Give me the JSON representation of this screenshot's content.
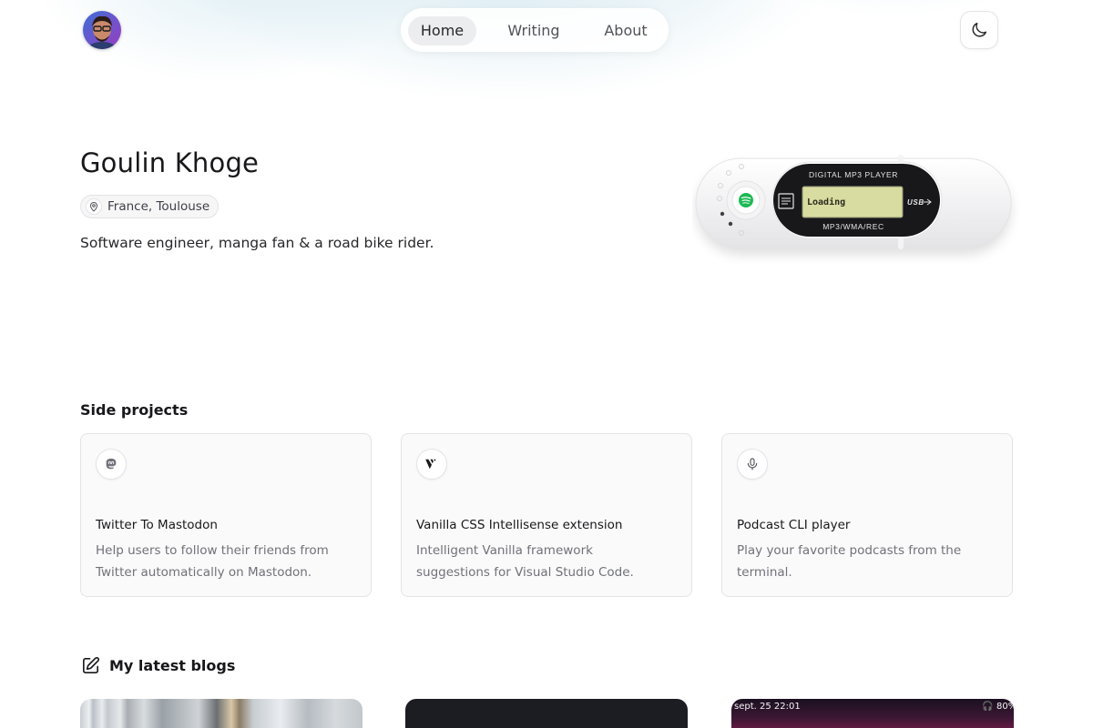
{
  "header": {
    "nav": [
      {
        "label": "Home",
        "active": true
      },
      {
        "label": "Writing",
        "active": false
      },
      {
        "label": "About",
        "active": false
      }
    ],
    "theme_icon": "moon-icon",
    "avatar_icon": "avatar-photo"
  },
  "intro": {
    "name": "Goulin Khoge",
    "location": "France, Toulouse",
    "location_icon": "map-pin-icon",
    "bio": "Software engineer, manga fan & a road bike rider."
  },
  "player": {
    "top_label": "DIGITAL MP3 PLAYER",
    "screen_text": "Loading",
    "bottom_label": "MP3/WMA/REC",
    "brand_icon": "spotify-icon",
    "usb_label": "USB"
  },
  "side_projects": {
    "title": "Side projects",
    "items": [
      {
        "icon": "mastodon-icon",
        "title": "Twitter To Mastodon",
        "description": "Help users to follow their friends from Twitter automatically on Mastodon."
      },
      {
        "icon": "vanilla-css-icon",
        "title": "Vanilla CSS Intellisense extension",
        "description": "Intelligent Vanilla framework suggestions for Visual Studio Code."
      },
      {
        "icon": "microphone-icon",
        "title": "Podcast CLI player",
        "description": "Play your favorite podcasts from the terminal."
      }
    ]
  },
  "blogs": {
    "title": "My latest blogs",
    "icon": "pencil-square-icon",
    "thumbnails": [
      {
        "status_left": "",
        "status_right": ""
      },
      {
        "status_left": "",
        "status_right": ""
      },
      {
        "status_left": "sept. 25  22:01",
        "status_right": "80%"
      }
    ]
  },
  "colors": {
    "accent_glow": "#b2d6e4",
    "card_background": "#fafafa",
    "border": "#e4e4e7",
    "muted_text": "#71717a"
  }
}
